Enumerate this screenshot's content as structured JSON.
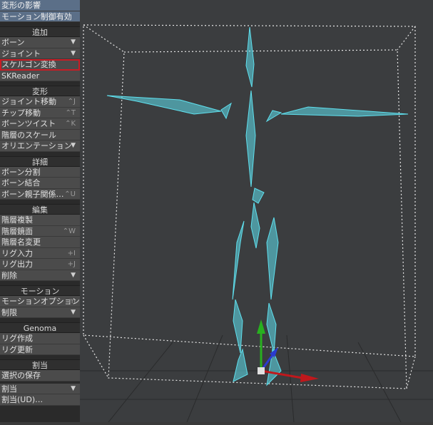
{
  "sidebar": {
    "top": [
      {
        "label": "変形の影響",
        "selected": true
      },
      {
        "label": "モーション制御有効",
        "selected": true
      }
    ],
    "add_header": "追加",
    "add_items": [
      {
        "label": "ボーン",
        "arrow": "▼"
      },
      {
        "label": "ジョイント",
        "arrow": "▼"
      },
      {
        "label": "スケルゴン変換"
      },
      {
        "label": "SKReader"
      }
    ],
    "deform_header": "変形",
    "deform_items": [
      {
        "label": "ジョイント移動",
        "shortcut": "⌃J"
      },
      {
        "label": "チップ移動",
        "shortcut": "⌃T"
      },
      {
        "label": "ボーンツイスト",
        "shortcut": "⌃K"
      },
      {
        "label": "階層のスケール"
      },
      {
        "label": "オリエンテーション",
        "arrow": "▼"
      }
    ],
    "detail_header": "詳細",
    "detail_items": [
      {
        "label": "ボーン分割"
      },
      {
        "label": "ボーン結合"
      },
      {
        "label": "ボーン親子関係…",
        "shortcut": "⌃U"
      }
    ],
    "edit_header": "編集",
    "edit_items": [
      {
        "label": "階層複製"
      },
      {
        "label": "階層鏡面",
        "shortcut": "⌃W"
      },
      {
        "label": "階層名変更"
      },
      {
        "label": "リグ入力",
        "shortcut": "+I"
      },
      {
        "label": "リグ出力",
        "shortcut": "+J"
      },
      {
        "label": "削除",
        "arrow": "▼"
      }
    ],
    "motion_header": "モーション",
    "motion_items": [
      {
        "label": "モーションオプション",
        "shortcut": "m"
      },
      {
        "label": "制限",
        "arrow": "▼"
      }
    ],
    "genoma_header": "Genoma",
    "genoma_items": [
      {
        "label": "リグ作成"
      },
      {
        "label": "リグ更新"
      }
    ],
    "assign_header": "割当",
    "assign_items": [
      {
        "label": "選択の保存"
      },
      {
        "label": "割当",
        "arrow": "▼"
      },
      {
        "label": "割当(UD)…"
      }
    ]
  },
  "colors": {
    "skeleton": "#5fe0ee",
    "highlight": "#c81d25",
    "axis_x": "#c0181c",
    "axis_y": "#28b01f",
    "axis_z": "#2a3bd0"
  }
}
